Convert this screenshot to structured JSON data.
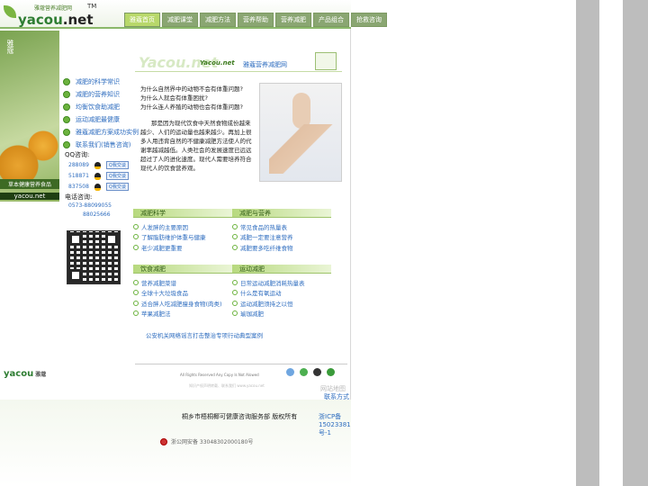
{
  "header": {
    "logo_main": "yacou",
    "logo_net": ".net",
    "logo_sub": "雅蔻营养减肥网",
    "tm": "TM",
    "nav": [
      "雅蔻首页",
      "减肥课堂",
      "减肥方法",
      "营养帮助",
      "营养减肥",
      "产品组合",
      "抢救咨询"
    ]
  },
  "left": {
    "vertical_text": "雅蔻",
    "caption": "草本健康营养食品",
    "caption2": "yacou.net",
    "bottom_logo": "yacou",
    "bottom_small": "雅蔻"
  },
  "banner": {
    "big": "Yacou.net",
    "tag": "Yacou.net",
    "tag2": "雅蔻营养减肥网"
  },
  "sidelinks": [
    "减肥的科学常识",
    "减肥的营养知识",
    "均衡饮食助减肥",
    "运动减肥最健康",
    "雅蔻减肥方案成功实例",
    "联系我们(销售咨询)"
  ],
  "contact": {
    "qq_label": "QQ咨询:",
    "qq": [
      {
        "num": "288089",
        "btn": "Q我交谈"
      },
      {
        "num": "518871",
        "btn": "Q我交谈"
      },
      {
        "num": "837508",
        "btn": "Q我交谈"
      }
    ],
    "tel_label": "电话咨询:",
    "tel1": "0573-88099055",
    "tel2": "88025666"
  },
  "intro": {
    "q1": "为什么自然界中的动物不会有体重问题?",
    "q2": "为什么人就会有体重困扰?",
    "q3": "为什么连人养殖的动物也会有体重问题?",
    "para": "那是因为现代饮食中天然食物成份越来越少、人们的运动量也越来越少。再加上很多人用违背自然的不健康减肥方法使人的代谢率越减越低。人类社会的发展速度已远远超过了人的进化速度。现代人需要培养符合现代人的饮食营养观。"
  },
  "sections": [
    {
      "title": "减肥科学",
      "items": [
        "人发胖的主要原因",
        "了解脂肪维护体重与健康",
        "老少减肥更重要"
      ]
    },
    {
      "title": "减肥与营养",
      "items": [
        "常见食品的热量表",
        "减肥一定要注意营养",
        "减肥要多吃纤维食物"
      ]
    },
    {
      "title": "饮食减肥",
      "items": [
        "营养减肥菜谱",
        "全球十大垃圾食品",
        "适合胖人吃减肥瘦身食物(肉类)",
        "苹果减肥法"
      ]
    },
    {
      "title": "运动减肥",
      "items": [
        "日常运动减肥消耗热量表",
        "什么是有氧运动",
        "运动减肥须持之以恒",
        "瑜珈减肥"
      ]
    }
  ],
  "police": "公安机关网络谣言打击整治专项行动典型案例",
  "footer": {
    "rights": "All Rights Reserved Any Copy Is Not Alowed",
    "dim": "知识产权声明转载、联系我们    www.yacou.net",
    "extra1": "网站地图",
    "extra2": "联系方式",
    "copyright": "桐乡市梧桐椰可健康咨询服务部 版权所有",
    "icp": "浙ICP备15023381号-1",
    "beian": "浙公网安备 33048302000180号"
  },
  "colors": {
    "accent": "#6cb33e",
    "link": "#2d6cbf",
    "nav": "#8aa672"
  }
}
